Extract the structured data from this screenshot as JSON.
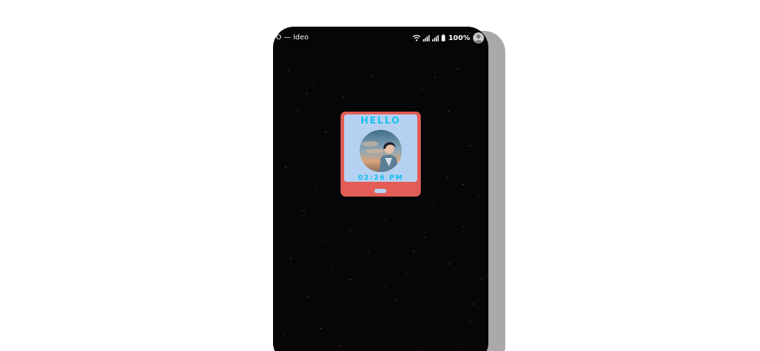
{
  "status_bar": {
    "left_text": "O — Ideo",
    "battery_percent": "100%",
    "icons": [
      "wifi-icon",
      "signal-icon",
      "signal-icon",
      "battery-icon",
      "profile-avatar-icon"
    ]
  },
  "widget": {
    "title": "HELLO",
    "time": "02:26 PM",
    "photo": "profile-photo-illustration"
  },
  "colors": {
    "wallpaper": "#060608",
    "widget_frame": "#e25d55",
    "widget_screen": "#b5d1f2",
    "widget_text": "#15c1ef"
  }
}
